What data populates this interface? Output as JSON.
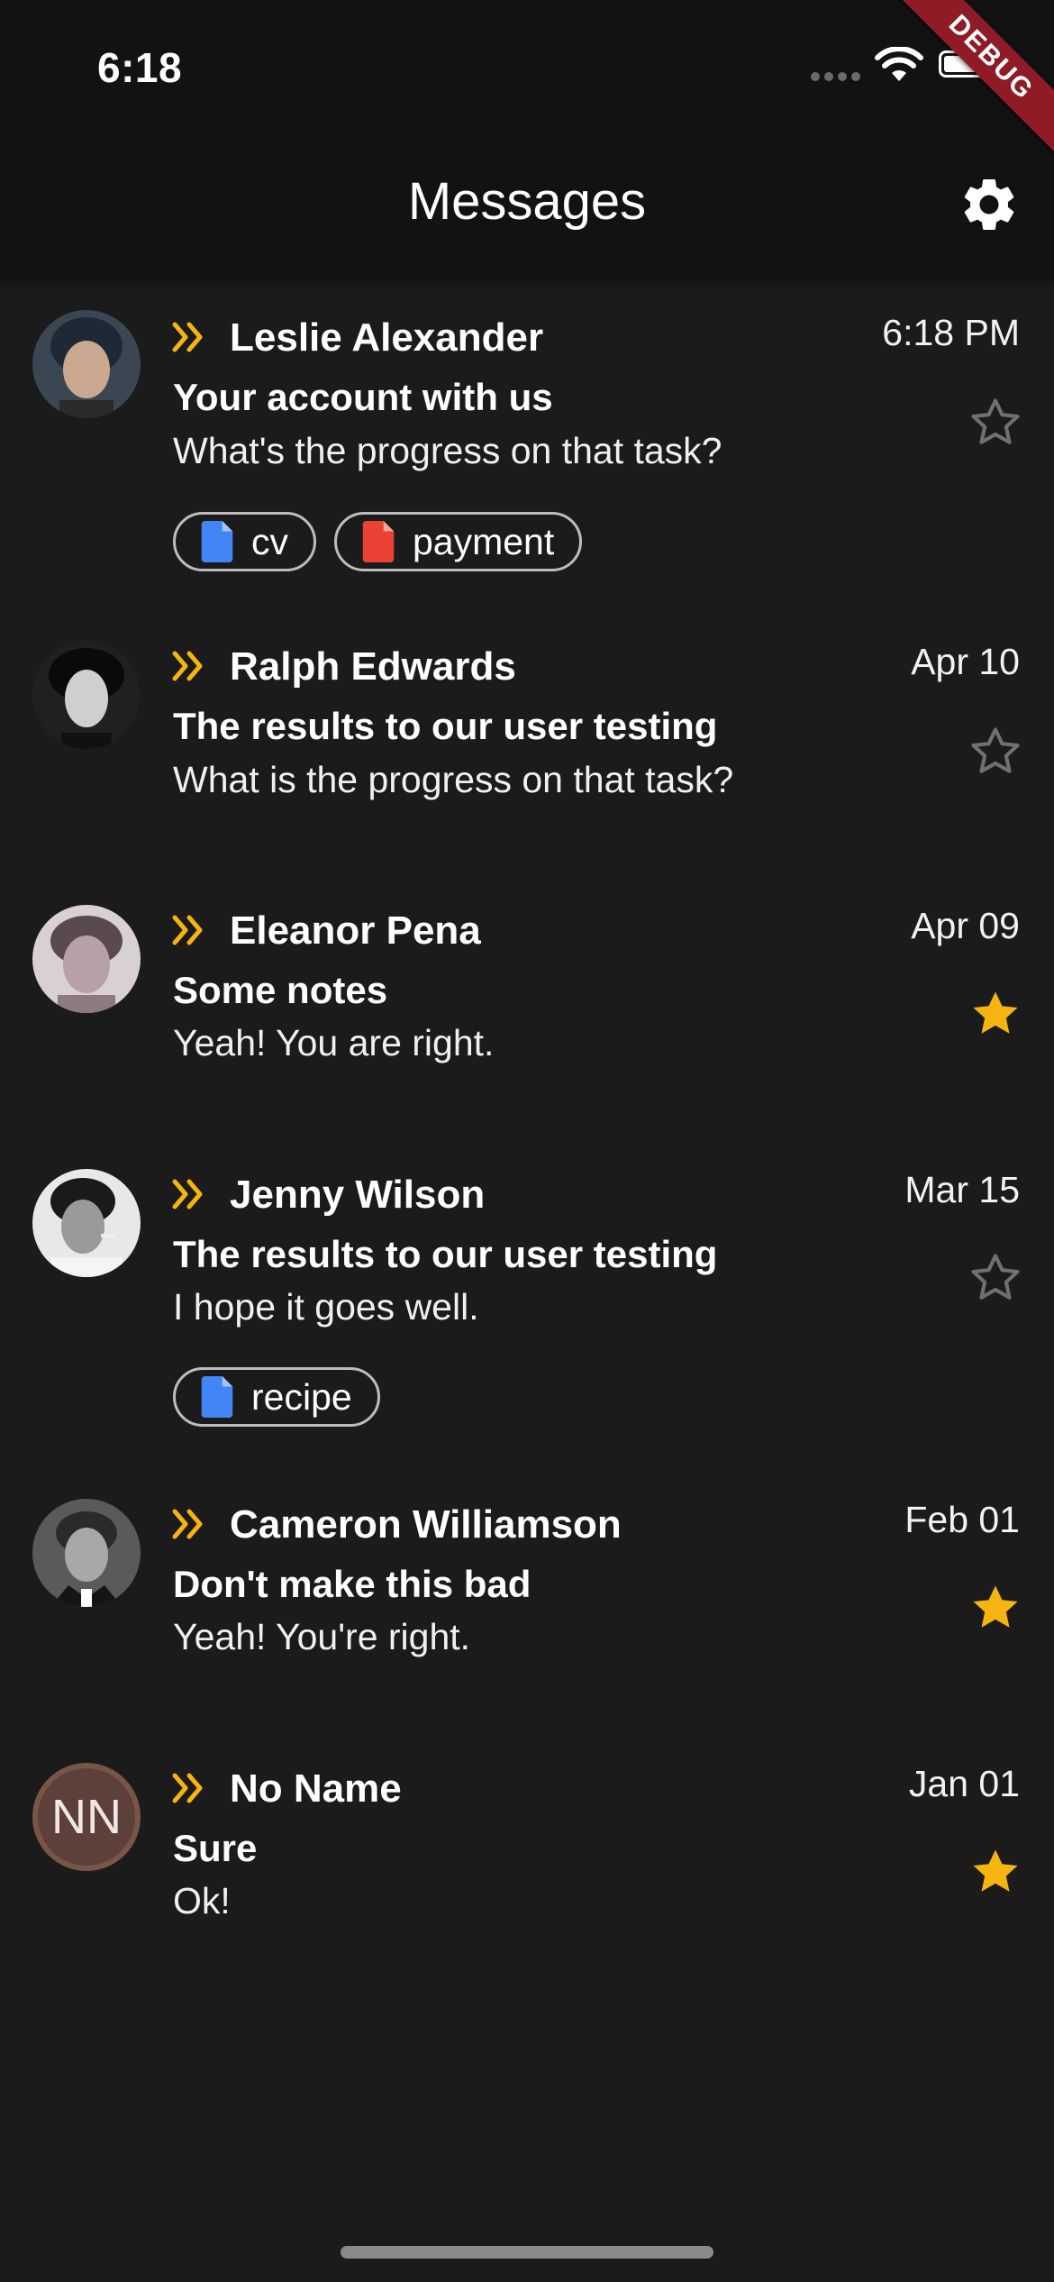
{
  "status_bar": {
    "time": "6:18"
  },
  "debug_banner": "DEBUG",
  "header": {
    "title": "Messages"
  },
  "colors": {
    "accent": "#f5b40f",
    "file_blue": "#4285f4",
    "file_red": "#ea4335",
    "background": "#1b1b1b",
    "appbar": "#121212"
  },
  "messages": [
    {
      "name": "Leslie Alexander",
      "date": "6:18 PM",
      "subject": "Your account with us",
      "preview": "What's the progress on that task?",
      "starred": false,
      "attachments": [
        {
          "label": "cv",
          "color": "blue"
        },
        {
          "label": "payment",
          "color": "red"
        }
      ]
    },
    {
      "name": "Ralph Edwards",
      "date": "Apr 10",
      "subject": "The results to our user testing",
      "preview": "What is the progress on that task?",
      "starred": false,
      "attachments": []
    },
    {
      "name": "Eleanor Pena",
      "date": "Apr 09",
      "subject": "Some notes",
      "preview": "Yeah! You are right.",
      "starred": true,
      "attachments": []
    },
    {
      "name": "Jenny Wilson",
      "date": "Mar 15",
      "subject": "The results to our user testing",
      "preview": "I hope it goes well.",
      "starred": false,
      "attachments": [
        {
          "label": "recipe",
          "color": "blue"
        }
      ]
    },
    {
      "name": "Cameron Williamson",
      "date": "Feb 01",
      "subject": "Don't make this bad",
      "preview": "Yeah! You're right.",
      "starred": true,
      "attachments": []
    },
    {
      "name": "No Name",
      "initials": "NN",
      "date": "Jan 01",
      "subject": "Sure",
      "preview": "Ok!",
      "starred": true,
      "attachments": []
    }
  ]
}
